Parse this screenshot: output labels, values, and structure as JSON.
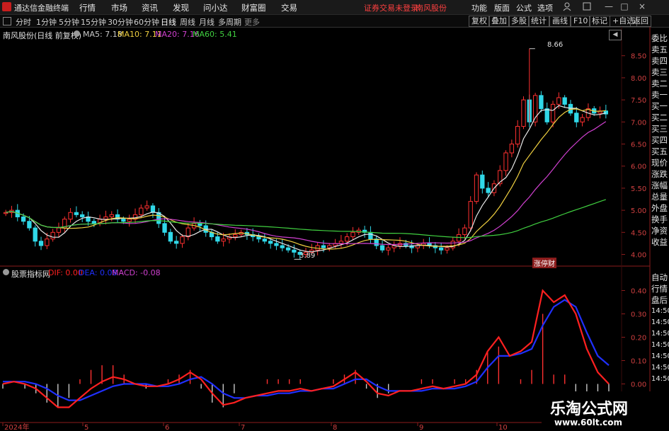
{
  "app": {
    "name": "通达信金融终端",
    "menu": [
      "行情",
      "市场",
      "资讯",
      "发现",
      "问小达",
      "财富圈",
      "交易"
    ],
    "status_text": "证券交易未登录",
    "stock_short": "南风股份",
    "right_menu": [
      "功能",
      "版面",
      "公式",
      "选项"
    ],
    "win_controls": [
      "—",
      "□",
      "×"
    ]
  },
  "tabs": {
    "periods": [
      "分时",
      "1分钟",
      "5分钟",
      "15分钟",
      "30分钟",
      "60分钟",
      "日线",
      "周线",
      "月线",
      "多周期",
      "更多"
    ],
    "active": "日线",
    "right_buttons": [
      "复权",
      "叠加",
      "多股",
      "统计",
      "画线",
      "F10",
      "标记",
      "+自选",
      "返回"
    ]
  },
  "main_chart": {
    "title": "南风股份(日线 前复权)",
    "ma_labels": [
      {
        "text": "MA5: 7.18",
        "color": "#e8e8e8"
      },
      {
        "text": "MA10: 7.11",
        "color": "#f0d040"
      },
      {
        "text": "MA20: 7.16",
        "color": "#d040d0"
      },
      {
        "text": "MA60: 5.41",
        "color": "#40d040"
      }
    ],
    "y_ticks": [
      "8.50",
      "8.00",
      "7.50",
      "7.00",
      "6.50",
      "6.00",
      "5.50",
      "5.00",
      "4.50",
      "4.00"
    ],
    "high_marker": "8.66",
    "low_marker": "3.89",
    "badge": "涨停财",
    "gear_icon": "gear-icon"
  },
  "sub_chart": {
    "title": "股票指标网",
    "dif": "DIF: 0.00",
    "dea": "DEA: 0.08",
    "macd": "MACD: -0.08",
    "y_ticks": [
      "0.40",
      "0.30",
      "0.20",
      "0.10",
      "0.00"
    ]
  },
  "x_axis": [
    "2024年",
    "5",
    "6",
    "7",
    "8",
    "9",
    "10"
  ],
  "side_panel_top": [
    "委比",
    "卖五",
    "卖四",
    "卖三",
    "卖二",
    "卖一",
    "买一",
    "买二",
    "买三",
    "买四",
    "买五",
    "现价",
    "涨跌",
    "涨幅",
    "总量",
    "外盘",
    "换手",
    "净资",
    "收益"
  ],
  "side_panel_bottom": [
    "自动",
    "行情",
    "盘后",
    "14:50",
    "14:50",
    "14:50",
    "14:50",
    "14:50",
    "14:50",
    "14:50"
  ],
  "watermark": {
    "title": "乐淘公式网",
    "url": "www.60lt.com"
  },
  "colors": {
    "up": "#ff3030",
    "down": "#30d8e8",
    "ma5": "#e8e8e8",
    "ma10": "#f0d040",
    "ma20": "#d040d0",
    "ma60": "#40d040",
    "dif": "#ff2020",
    "dea": "#2030ff"
  },
  "chart_data": [
    {
      "type": "candlestick",
      "title": "南风股份(日线 前复权)",
      "ylim": [
        3.8,
        8.8
      ],
      "close_series": [
        4.95,
        5.0,
        4.85,
        4.75,
        4.6,
        4.3,
        4.2,
        4.35,
        4.5,
        4.6,
        4.8,
        4.95,
        4.9,
        4.85,
        4.75,
        4.7,
        4.8,
        4.85,
        4.9,
        4.8,
        4.75,
        4.8,
        4.9,
        5.05,
        5.1,
        4.95,
        4.7,
        4.5,
        4.3,
        4.25,
        4.4,
        4.6,
        4.7,
        4.65,
        4.5,
        4.4,
        4.3,
        4.35,
        4.4,
        4.45,
        4.5,
        4.45,
        4.4,
        4.35,
        4.3,
        4.25,
        4.2,
        4.15,
        4.1,
        4.05,
        4.0,
        4.05,
        4.1,
        4.2,
        4.15,
        4.2,
        4.25,
        4.3,
        4.4,
        4.5,
        4.55,
        4.5,
        4.35,
        4.2,
        4.1,
        4.15,
        4.2,
        4.25,
        4.2,
        4.15,
        4.2,
        4.25,
        4.2,
        4.15,
        4.1,
        4.15,
        4.3,
        4.45,
        4.6,
        5.2,
        5.8,
        5.5,
        5.4,
        5.6,
        5.9,
        6.3,
        6.5,
        6.9,
        7.5,
        7.0,
        7.6,
        7.3,
        7.0,
        7.4,
        7.55,
        7.4,
        7.2,
        7.0,
        7.1,
        7.3,
        7.2,
        7.25,
        7.18
      ],
      "ma5_last": 7.18,
      "ma10_last": 7.11,
      "ma20_last": 7.16,
      "ma60_last": 5.41,
      "high": 8.66,
      "low": 3.89
    },
    {
      "type": "line",
      "title": "股票指标网",
      "ylim": [
        -0.15,
        0.45
      ],
      "series": [
        {
          "name": "DIF",
          "values": [
            0.0,
            0.01,
            0.0,
            -0.02,
            -0.06,
            -0.1,
            -0.1,
            -0.06,
            -0.02,
            0.01,
            0.03,
            0.02,
            0.0,
            -0.01,
            -0.01,
            0.0,
            0.02,
            0.05,
            0.02,
            -0.04,
            -0.09,
            -0.08,
            -0.06,
            -0.05,
            -0.04,
            -0.03,
            -0.03,
            -0.02,
            -0.03,
            -0.02,
            -0.01,
            0.02,
            0.05,
            0.01,
            -0.04,
            -0.05,
            -0.03,
            -0.03,
            -0.02,
            -0.01,
            -0.02,
            -0.01,
            0.0,
            0.04,
            0.14,
            0.2,
            0.12,
            0.14,
            0.18,
            0.4,
            0.35,
            0.38,
            0.3,
            0.15,
            0.05,
            0.0
          ]
        },
        {
          "name": "DEA",
          "values": [
            0.01,
            0.01,
            0.01,
            0.0,
            -0.02,
            -0.05,
            -0.07,
            -0.07,
            -0.05,
            -0.03,
            -0.01,
            0.0,
            0.0,
            0.0,
            -0.01,
            -0.01,
            0.0,
            0.02,
            0.03,
            0.0,
            -0.04,
            -0.06,
            -0.06,
            -0.05,
            -0.05,
            -0.04,
            -0.04,
            -0.03,
            -0.03,
            -0.02,
            -0.02,
            0.0,
            0.02,
            0.02,
            -0.01,
            -0.03,
            -0.03,
            -0.03,
            -0.03,
            -0.02,
            -0.02,
            -0.02,
            -0.01,
            0.01,
            0.07,
            0.12,
            0.12,
            0.13,
            0.15,
            0.25,
            0.33,
            0.36,
            0.33,
            0.22,
            0.12,
            0.08
          ]
        }
      ],
      "labels": {
        "DIF": 0.0,
        "DEA": 0.08,
        "MACD": -0.08
      }
    }
  ]
}
